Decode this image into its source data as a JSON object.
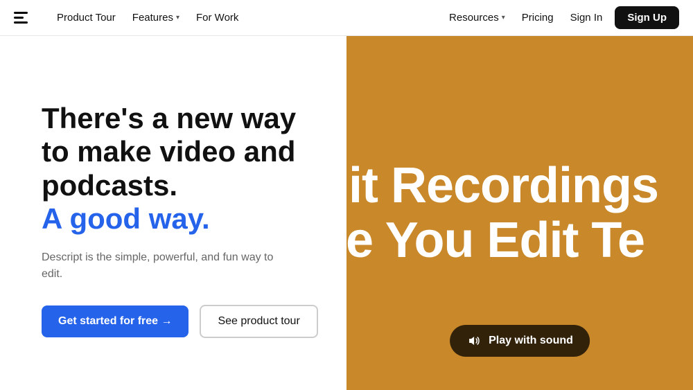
{
  "nav": {
    "logo_label": "Descript logo",
    "links": [
      {
        "label": "Product Tour",
        "has_dropdown": false
      },
      {
        "label": "Features",
        "has_dropdown": true
      },
      {
        "label": "For Work",
        "has_dropdown": false
      }
    ],
    "right_links": [
      {
        "label": "Resources",
        "has_dropdown": true
      },
      {
        "label": "Pricing",
        "has_dropdown": false
      },
      {
        "label": "Sign In",
        "has_dropdown": false
      }
    ],
    "signup_label": "Sign Up"
  },
  "hero": {
    "heading_part1": "There's a new way to make video and podcasts.",
    "heading_highlight": "A good way.",
    "subtext": "Descript is the simple, powerful, and fun way to edit.",
    "cta_primary": "Get started for free →",
    "cta_secondary": "See product tour"
  },
  "video_panel": {
    "overlay_line1": "dit Recordings",
    "overlay_line2": "ke You Edit Te",
    "play_sound_label": "Play with sound"
  },
  "colors": {
    "blue_accent": "#2563eb",
    "video_bg": "#c9892a"
  }
}
